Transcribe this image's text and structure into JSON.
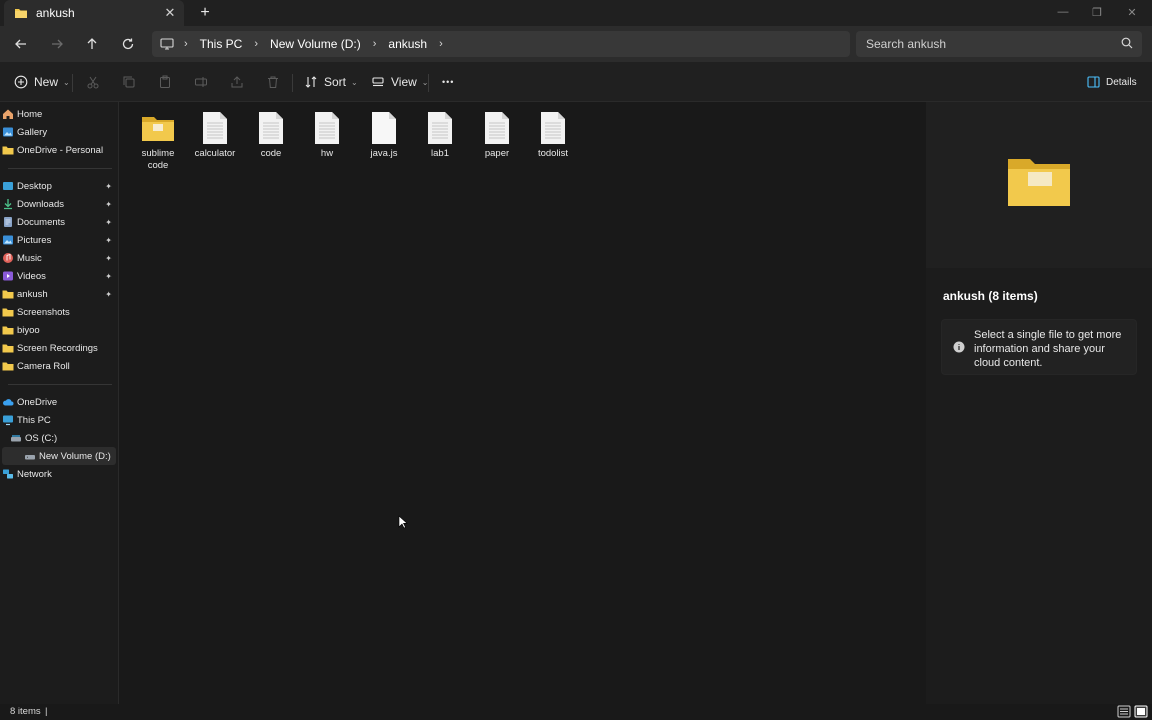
{
  "tab": {
    "title": "ankush",
    "close": "✕",
    "new_tab": "+"
  },
  "window_controls": {
    "minimize": "—",
    "maximize": "❐",
    "close": "✕"
  },
  "breadcrumb": {
    "items": [
      "This PC",
      "New Volume (D:)",
      "ankush"
    ],
    "separator": "›"
  },
  "search": {
    "placeholder": "Search ankush"
  },
  "commandbar": {
    "new": "New",
    "sort": "Sort",
    "view": "View",
    "more": "•••",
    "details": "Details"
  },
  "sidebar": {
    "quick": [
      {
        "label": "Home",
        "icon": "home-icon"
      },
      {
        "label": "Gallery",
        "icon": "gallery-icon"
      },
      {
        "label": "OneDrive - Personal",
        "icon": "folder-icon"
      }
    ],
    "pinned": [
      {
        "label": "Desktop",
        "icon": "desktop-icon",
        "pinned": true
      },
      {
        "label": "Downloads",
        "icon": "download-icon",
        "pinned": true
      },
      {
        "label": "Documents",
        "icon": "document-icon",
        "pinned": true
      },
      {
        "label": "Pictures",
        "icon": "pictures-icon",
        "pinned": true
      },
      {
        "label": "Music",
        "icon": "music-icon",
        "pinned": true
      },
      {
        "label": "Videos",
        "icon": "videos-icon",
        "pinned": true
      },
      {
        "label": "ankush",
        "icon": "folder-icon",
        "pinned": true
      },
      {
        "label": "Screenshots",
        "icon": "folder-icon",
        "pinned": false
      },
      {
        "label": "biyoo",
        "icon": "folder-icon",
        "pinned": false
      },
      {
        "label": "Screen Recordings",
        "icon": "folder-icon",
        "pinned": false
      },
      {
        "label": "Camera Roll",
        "icon": "folder-icon",
        "pinned": false
      }
    ],
    "locations": [
      {
        "label": "OneDrive",
        "icon": "cloud-icon"
      },
      {
        "label": "This PC",
        "icon": "monitor-icon"
      },
      {
        "label": "OS (C:)",
        "icon": "drive-icon"
      },
      {
        "label": "New Volume (D:)",
        "icon": "drive-icon",
        "selected": true
      },
      {
        "label": "Network",
        "icon": "network-icon"
      }
    ],
    "pin_glyph": "📌"
  },
  "files": [
    {
      "name": "sublime code",
      "type": "folder"
    },
    {
      "name": "calculator",
      "type": "file"
    },
    {
      "name": "code",
      "type": "file"
    },
    {
      "name": "hw",
      "type": "file"
    },
    {
      "name": "java.js",
      "type": "file-blank"
    },
    {
      "name": "lab1",
      "type": "file"
    },
    {
      "name": "paper",
      "type": "file"
    },
    {
      "name": "todolist",
      "type": "file"
    }
  ],
  "details": {
    "title": "ankush (8 items)",
    "info": "Select a single file to get more information and share your cloud content."
  },
  "status": {
    "items": "8 items",
    "caret": "|"
  },
  "colors": {
    "folder": "#f2c94c",
    "folder_dark": "#d9a929",
    "accent": "#4cc2ff"
  }
}
